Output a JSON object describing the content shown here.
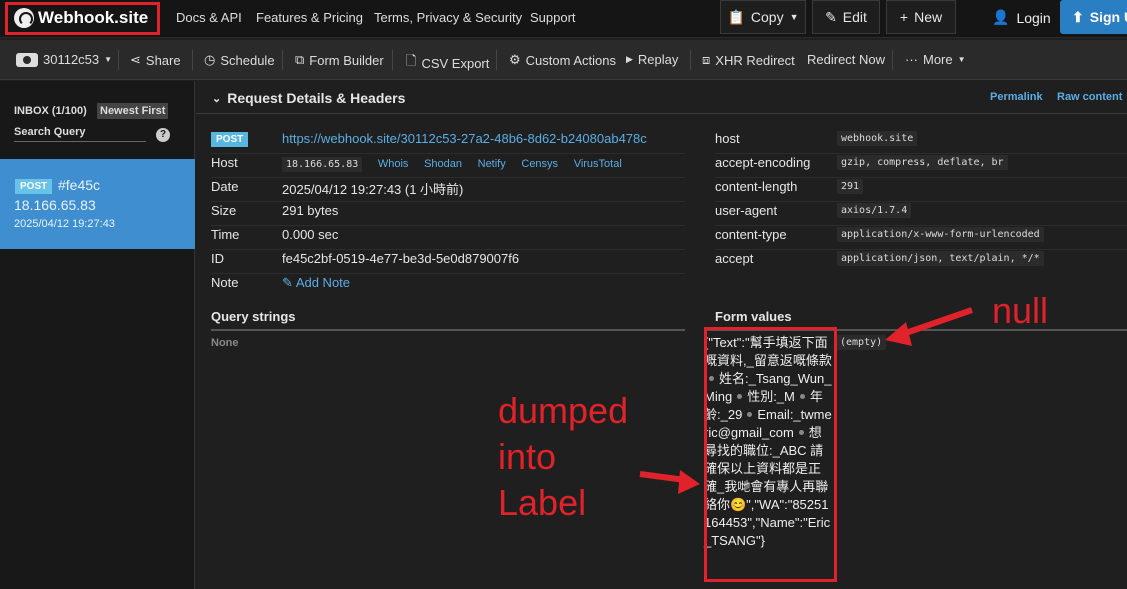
{
  "navbar": {
    "brand": "Webhook.site",
    "links": [
      "Docs & API",
      "Features & Pricing",
      "Terms, Privacy & Security",
      "Support"
    ],
    "copy_label": "Copy",
    "edit_label": "Edit",
    "new_label": "New",
    "login_label": "Login",
    "signup_label": "Sign U"
  },
  "toolbar": {
    "token": "30112c53",
    "items": [
      "Share",
      "Schedule",
      "Form Builder",
      "CSV Export",
      "Custom Actions",
      "Replay",
      "XHR Redirect",
      "Redirect Now",
      "More"
    ]
  },
  "sidebar": {
    "inbox": "INBOX (1/100)",
    "sort": "Newest First",
    "search_placeholder": "Search Query",
    "help": "?",
    "requests": [
      {
        "method": "POST",
        "hash": "#fe45c",
        "ip": "18.166.65.83",
        "date": "2025/04/12 19:27:43"
      }
    ]
  },
  "details": {
    "title": "Request Details & Headers",
    "permalink": "Permalink",
    "raw_content": "Raw content",
    "method": "POST",
    "url": "https://webhook.site/30112c53-27a2-48b6-8d62-b24080ab478c",
    "host_label": "Host",
    "host_value": "18.166.65.83",
    "host_links": [
      "Whois",
      "Shodan",
      "Netify",
      "Censys",
      "VirusTotal"
    ],
    "date_label": "Date",
    "date_value": "2025/04/12 19:27:43 (1 小時前)",
    "size_label": "Size",
    "size_value": "291 bytes",
    "time_label": "Time",
    "time_value": "0.000 sec",
    "id_label": "ID",
    "id_value": "fe45c2bf-0519-4e77-be3d-5e0d879007f6",
    "note_label": "Note",
    "add_note": "Add Note"
  },
  "headers": [
    {
      "name": "host",
      "value": "webhook.site"
    },
    {
      "name": "accept-encoding",
      "value": "gzip, compress, deflate, br"
    },
    {
      "name": "content-length",
      "value": "291"
    },
    {
      "name": "user-agent",
      "value": "axios/1.7.4"
    },
    {
      "name": "content-type",
      "value": "application/x-www-form-urlencoded"
    },
    {
      "name": "accept",
      "value": "application/json, text/plain, */*"
    }
  ],
  "query": {
    "title": "Query strings",
    "none": "None"
  },
  "form": {
    "title": "Form values",
    "key_parts": [
      "{\"Text\":\"幫手填返下面嘅資料,_留意返嘅條款",
      "姓名:_Tsang_Wun_Ming",
      "性別:_M",
      "年齡:_29",
      "Email:_twmeric@gmail_com",
      "想尋找的職位:_ABC 請確保以上資料都是正確_我哋會有專人再聯絡你😊\",\"WA\":\"85251164453\",\"Name\":\"Eric_TSANG\"}"
    ],
    "value": "(empty)"
  },
  "annotations": {
    "null_text": "null",
    "dumped_lines": [
      "dumped",
      "into",
      "Label"
    ]
  },
  "colors": {
    "accent": "#5aaee5",
    "annotation": "#e0222a",
    "selected": "#3f8fd0"
  }
}
